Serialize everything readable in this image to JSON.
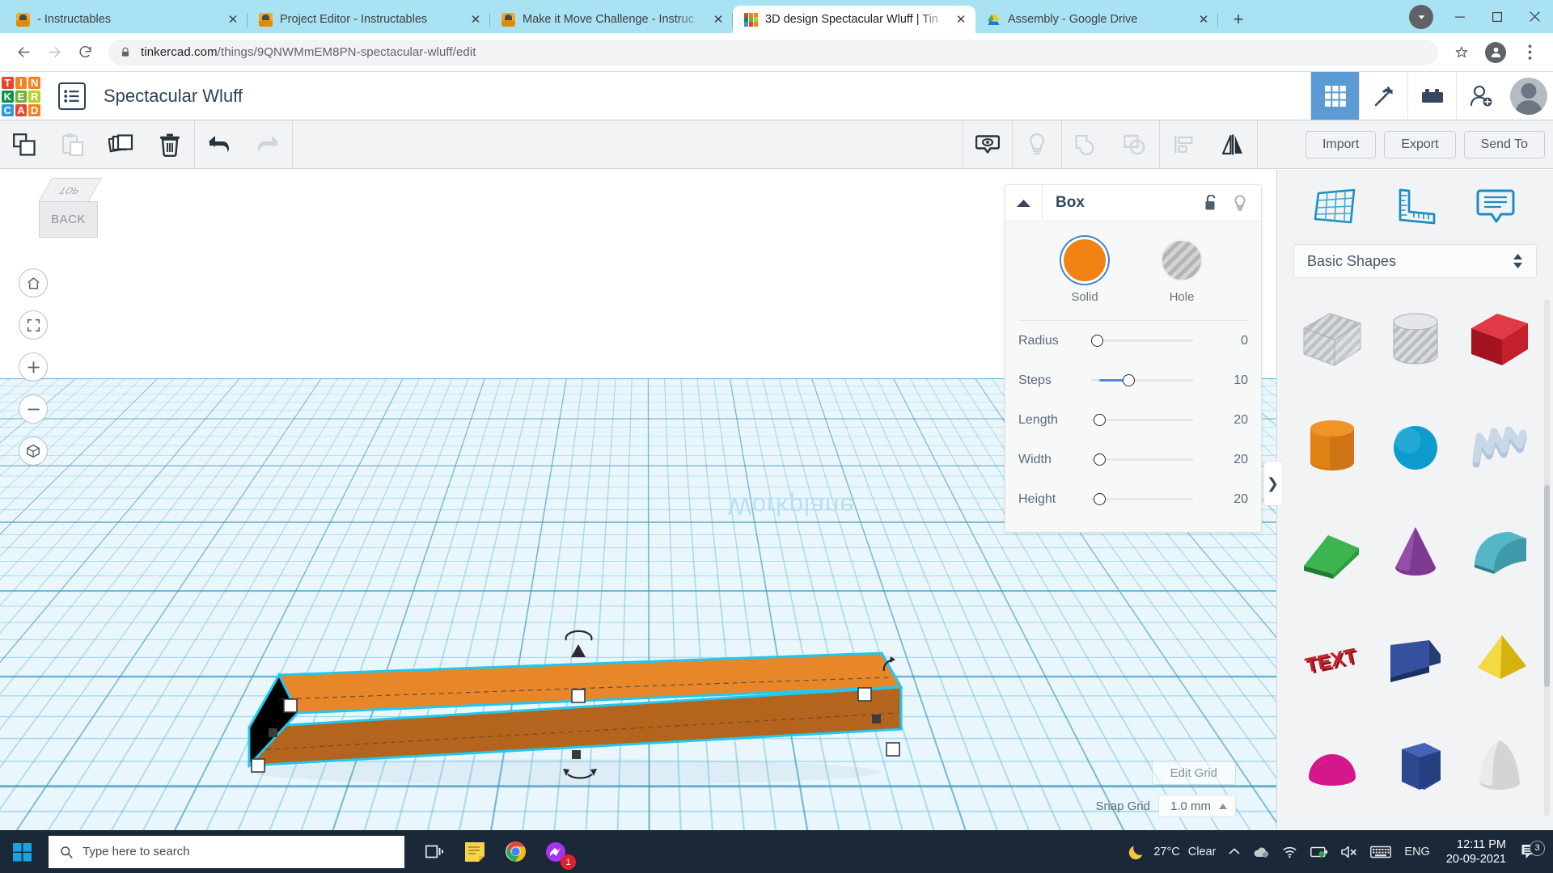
{
  "browser": {
    "tabs": [
      {
        "title": "- Instructables",
        "favicon": "instructables-icon",
        "active": false
      },
      {
        "title": "Project Editor - Instructables",
        "favicon": "instructables-icon",
        "active": false
      },
      {
        "title": "Make it Move Challenge - Instruc",
        "favicon": "instructables-icon",
        "active": false
      },
      {
        "title": "3D design Spectacular Wluff | Tin",
        "favicon": "tinkercad-icon",
        "active": true
      },
      {
        "title": "Assembly - Google Drive",
        "favicon": "google-drive-icon",
        "active": false
      }
    ],
    "close_label": "✕",
    "new_tab_label": "+",
    "window_controls": {
      "minimize": "─",
      "maximize": "☐",
      "close": "✕"
    },
    "nav": {
      "back": "←",
      "forward": "→",
      "reload": "⟳"
    },
    "omnibox": {
      "url_domain": "tinkercad.com",
      "url_path": "/things/9QNWMmEM8PN-spectacular-wluff/edit",
      "lock_icon": "lock-icon",
      "star_icon": "bookmark-star-icon"
    }
  },
  "tinkercad": {
    "logo_letters": [
      "T",
      "I",
      "N",
      "K",
      "E",
      "R",
      "C",
      "A",
      "D"
    ],
    "logo_colors": [
      "#e8432e",
      "#f58220",
      "#f58220",
      "#0f9347",
      "#6cb33f",
      "#b5cf2f",
      "#2f9bd6",
      "#e8432e",
      "#f58220"
    ],
    "project_title": "Spectacular Wluff",
    "header_icons": [
      {
        "name": "grid-view-icon",
        "active": true
      },
      {
        "name": "codeblocks-pickaxe-icon",
        "active": false
      },
      {
        "name": "blocks-icon",
        "active": false
      },
      {
        "name": "invite-people-icon",
        "active": false
      }
    ],
    "avatar_name": "user-avatar",
    "toolbar": {
      "left_icons": [
        {
          "name": "copy-icon",
          "disabled": false
        },
        {
          "name": "paste-icon",
          "disabled": true
        },
        {
          "name": "duplicate-icon",
          "disabled": false
        },
        {
          "name": "delete-icon",
          "disabled": false
        },
        {
          "name": "undo-icon",
          "disabled": false
        },
        {
          "name": "redo-icon",
          "disabled": true
        }
      ],
      "right_icons": [
        {
          "name": "show-hide-eye-icon",
          "disabled": false
        },
        {
          "name": "lightbulb-icon",
          "disabled": true
        },
        {
          "name": "group-icon",
          "disabled": true
        },
        {
          "name": "ungroup-icon",
          "disabled": true
        },
        {
          "name": "align-icon",
          "disabled": true
        },
        {
          "name": "mirror-flip-icon",
          "disabled": false
        }
      ],
      "import_label": "Import",
      "export_label": "Export",
      "sendto_label": "Send To"
    }
  },
  "canvas": {
    "workplane_label": "Workplane",
    "viewcube": {
      "top_label": "TOP",
      "front_label": "BACK"
    },
    "view_tools": [
      {
        "name": "home-view-icon",
        "glyph": "⌂"
      },
      {
        "name": "fit-to-view-icon",
        "glyph": "⛶"
      },
      {
        "name": "zoom-in-icon",
        "glyph": "+"
      },
      {
        "name": "zoom-out-icon",
        "glyph": "−"
      },
      {
        "name": "orthographic-toggle-icon",
        "glyph": "⬡"
      }
    ],
    "edit_grid_label": "Edit Grid",
    "snap_grid_label": "Snap Grid",
    "snap_grid_value": "1.0 mm",
    "shape_color": "#e8862a"
  },
  "box_panel": {
    "title": "Box",
    "collapse_icon": "collapse-caret-icon",
    "lock_icon": "unlock-icon",
    "light_icon": "lightbulb-icon",
    "modes": [
      {
        "label": "Solid",
        "color": "#f08314",
        "selected": true
      },
      {
        "label": "Hole",
        "color": "#b4b4b4",
        "selected": false
      }
    ],
    "sliders": [
      {
        "label": "Radius",
        "value": "0",
        "pct": 0
      },
      {
        "label": "Steps",
        "value": "10",
        "pct": 32
      },
      {
        "label": "Length",
        "value": "20",
        "pct": 5
      },
      {
        "label": "Width",
        "value": "20",
        "pct": 5
      },
      {
        "label": "Height",
        "value": "20",
        "pct": 5
      }
    ]
  },
  "shapes_panel": {
    "top_icons": [
      {
        "name": "workplane-icon"
      },
      {
        "name": "ruler-icon"
      },
      {
        "name": "note-icon"
      }
    ],
    "category_label": "Basic Shapes",
    "shapes": [
      {
        "name": "box-hole-shape",
        "color": "#c9ccce",
        "kind": "cube-striped"
      },
      {
        "name": "cylinder-hole-shape",
        "color": "#c9ccce",
        "kind": "cylinder-striped"
      },
      {
        "name": "box-shape",
        "color": "#c4202b",
        "kind": "cube"
      },
      {
        "name": "cylinder-shape",
        "color": "#e08214",
        "kind": "cylinder"
      },
      {
        "name": "sphere-shape",
        "color": "#0e9ccc",
        "kind": "sphere"
      },
      {
        "name": "scribble-shape",
        "color": "#b0c6da",
        "kind": "scribble"
      },
      {
        "name": "roof-shape",
        "color": "#2a9e3f",
        "kind": "roof"
      },
      {
        "name": "cone-shape",
        "color": "#7e3a93",
        "kind": "cone"
      },
      {
        "name": "halfcylinder-shape",
        "color": "#53b7c6",
        "kind": "halfcylinder"
      },
      {
        "name": "text-shape",
        "color": "#c4202b",
        "kind": "text"
      },
      {
        "name": "wedge-shape",
        "color": "#2c3f80",
        "kind": "wedge"
      },
      {
        "name": "pyramid-shape",
        "color": "#e8c81e",
        "kind": "pyramid"
      },
      {
        "name": "halfsphere-shape",
        "color": "#d4188c",
        "kind": "halfsphere"
      },
      {
        "name": "polygon-shape",
        "color": "#2c3f80",
        "kind": "polygon"
      },
      {
        "name": "paraboloid-shape",
        "color": "#d2d4d6",
        "kind": "paraboloid"
      }
    ]
  },
  "taskbar": {
    "start_icon": "windows-start-icon",
    "search_placeholder": "Type here to search",
    "search_icon": "search-icon",
    "apps": [
      {
        "name": "task-view-icon"
      },
      {
        "name": "sticky-notes-icon"
      },
      {
        "name": "chrome-icon"
      },
      {
        "name": "messenger-icon",
        "badge": "1"
      }
    ],
    "weather_icon": "moon-icon",
    "weather_temp": "27°C",
    "weather_cond": "Clear",
    "tray_icons": [
      {
        "name": "show-hidden-icons-chevron"
      },
      {
        "name": "onedrive-icon"
      },
      {
        "name": "wifi-icon"
      },
      {
        "name": "battery-icon"
      },
      {
        "name": "volume-muted-icon"
      },
      {
        "name": "keyboard-icon"
      }
    ],
    "language": "ENG",
    "time": "12:11 PM",
    "date": "20-09-2021",
    "action_center_icon": "action-center-icon",
    "action_center_badge": "3"
  }
}
